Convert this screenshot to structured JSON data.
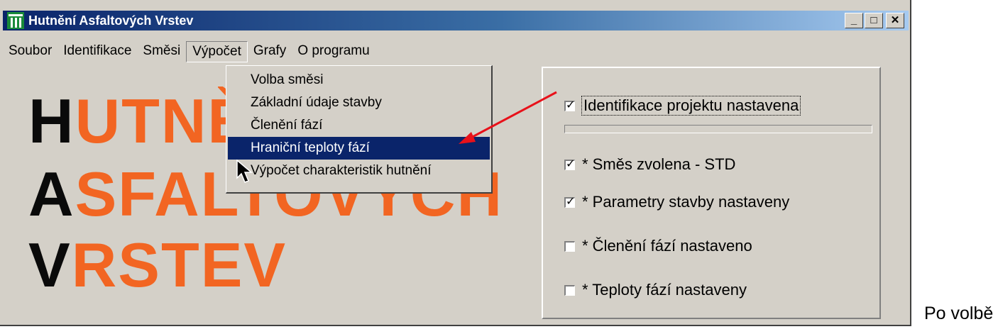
{
  "window": {
    "title": "Hutnění Asfaltových Vrstev",
    "icon": "road-sign-icon",
    "buttons": {
      "minimize": "_",
      "maximize": "□",
      "close": "✕"
    }
  },
  "menu": {
    "items": [
      "Soubor",
      "Identifikace",
      "Směsi",
      "Výpočet",
      "Grafy",
      "O programu"
    ],
    "active": "Výpočet"
  },
  "dropdown": {
    "items": [
      "Volba směsi",
      "Základní údaje stavby",
      "Členění fází",
      "Hraniční teploty fází",
      "Výpočet charakteristik hutnění"
    ],
    "highlighted": "Hraniční teploty fází"
  },
  "logo": {
    "line1_first": "H",
    "line1_rest": "UTNĚ",
    "line2_first": "A",
    "line2_rest": "SFALTOVÝCH",
    "line3_first": "V",
    "line3_rest": "RSTEV",
    "first_color": "#0a0a0a",
    "accent_color": "#f26522"
  },
  "status": {
    "project": {
      "label": "Identifikace projektu nastavena",
      "checked": true
    },
    "items": [
      {
        "label": "* Směs zvolena - STD",
        "checked": true
      },
      {
        "label": "* Parametry stavby nastaveny",
        "checked": true
      },
      {
        "label": "* Členění fází nastaveno",
        "checked": false
      },
      {
        "label": "* Teploty fází nastaveny",
        "checked": false
      }
    ]
  },
  "side_text": "Po volbě",
  "annotation_color": "#e8111a"
}
